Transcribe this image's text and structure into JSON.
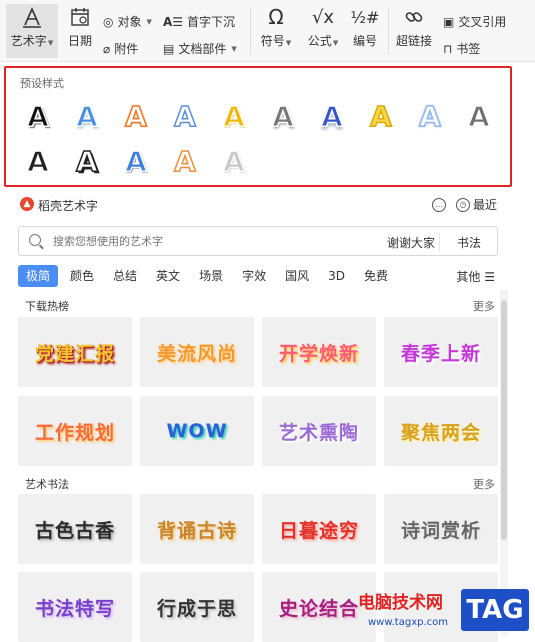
{
  "ribbon": {
    "art_text": "艺术字",
    "date": "日期",
    "object": "对象",
    "attachment": "附件",
    "drop_cap": "首字下沉",
    "doc_parts": "文档部件",
    "symbol": "符号",
    "formula": "公式",
    "numbering": "编号",
    "hyperlink": "超链接",
    "cross_ref": "交叉引用",
    "bookmark": "书签"
  },
  "preset": {
    "title": "预设样式",
    "glyph": "A",
    "styles": [
      {
        "fill": "#111111",
        "stroke": "#ffffff",
        "shadow": "2px 2px 0 #888"
      },
      {
        "fill": "#4a90e2",
        "stroke": "#ffffff",
        "shadow": "1px 2px 2px #9bb"
      },
      {
        "fill": "#ffffff",
        "stroke": "#e87b2a",
        "shadow": "0 0 2px #e87b2a"
      },
      {
        "fill": "#ffffff",
        "stroke": "#5b8fd6",
        "shadow": "none"
      },
      {
        "fill": "#f2b705",
        "stroke": "#ffffff",
        "shadow": "1px 1px 1px #c90"
      },
      {
        "fill": "#777777",
        "stroke": "#ffffff",
        "shadow": "1px 2px 2px #999"
      },
      {
        "fill": "#3657c7",
        "stroke": "#ffffff",
        "shadow": "0 3px 3px #9ab"
      },
      {
        "fill": "#f5d84a",
        "stroke": "#e0a800",
        "shadow": "none"
      },
      {
        "fill": "#ffffff",
        "stroke": "#8fb6ea",
        "shadow": "0 0 3px #8fb6ea"
      },
      {
        "fill": "#707070",
        "stroke": "#ffffff",
        "shadow": "none"
      },
      {
        "fill": "#222222",
        "stroke": "#ffffff",
        "shadow": "0 0 0 #000"
      },
      {
        "fill": "#ffffff",
        "stroke": "#222222",
        "shadow": "2px 2px 0 #222"
      },
      {
        "fill": "#3e7ede",
        "stroke": "#ffffff",
        "shadow": "1px 1px 1px #224"
      },
      {
        "fill": "#ffffff",
        "stroke": "#f08f3a",
        "shadow": "none"
      },
      {
        "fill": "#c8c8c8",
        "stroke": "#ffffff",
        "shadow": "1px 1px 1px #999"
      }
    ]
  },
  "daoke": {
    "title": "稻壳艺术字",
    "logo": "▲",
    "recent": "最近"
  },
  "search": {
    "placeholder": "搜索您想使用的艺术字",
    "chip1": "谢谢大家",
    "chip2": "书法"
  },
  "categories": [
    "极简",
    "颜色",
    "总结",
    "英文",
    "场景",
    "字效",
    "国风",
    "3D",
    "免费"
  ],
  "more_categories": "其他 ☰",
  "hot": {
    "title": "下载热榜",
    "more": "更多",
    "cards": [
      {
        "text": "党建汇报",
        "color": "#f2c531",
        "shadow": "#b01b1b"
      },
      {
        "text": "美流风尚",
        "color": "#f39a2a",
        "shadow": "#ffd9a6"
      },
      {
        "text": "开学焕新",
        "color": "#ff5a7a",
        "shadow": "#ffd46b"
      },
      {
        "text": "春季上新",
        "color": "#c438d8",
        "shadow": "#ffffff"
      },
      {
        "text": "工作规划",
        "color": "#f76a3c",
        "shadow": "#ffd28a"
      },
      {
        "text": "WOW",
        "color": "#2f5ed8",
        "shadow": "#44d4c0"
      },
      {
        "text": "艺术熏陶",
        "color": "#9b6bd4",
        "shadow": "#ffffff"
      },
      {
        "text": "聚焦两会",
        "color": "#d9a21c",
        "shadow": "#fff3c0"
      }
    ]
  },
  "calligraphy": {
    "title": "艺术书法",
    "more": "更多",
    "cards": [
      {
        "text": "古色古香",
        "color": "#2b2b2b",
        "shadow": "#bbbbbb"
      },
      {
        "text": "背诵古诗",
        "color": "#c9852e",
        "shadow": "#f3d59a"
      },
      {
        "text": "日暮途穷",
        "color": "#e3322b",
        "shadow": "#f9b8b0"
      },
      {
        "text": "诗词赏析",
        "color": "#666666",
        "shadow": "#e8e8e8"
      },
      {
        "text": "书法特写",
        "color": "#7a3fc9",
        "shadow": "#d9c4f3"
      },
      {
        "text": "行成于思",
        "color": "#333333",
        "shadow": "#cccccc"
      },
      {
        "text": "史论结合",
        "color": "#a3227a",
        "shadow": "#f0c3e0"
      },
      {
        "text": "",
        "color": "#2b6fd6",
        "shadow": "#c3dcf7"
      }
    ]
  },
  "watermark": {
    "line1": "电脑技术网",
    "line2": "www.tagxp.com",
    "tag": "TAG"
  }
}
